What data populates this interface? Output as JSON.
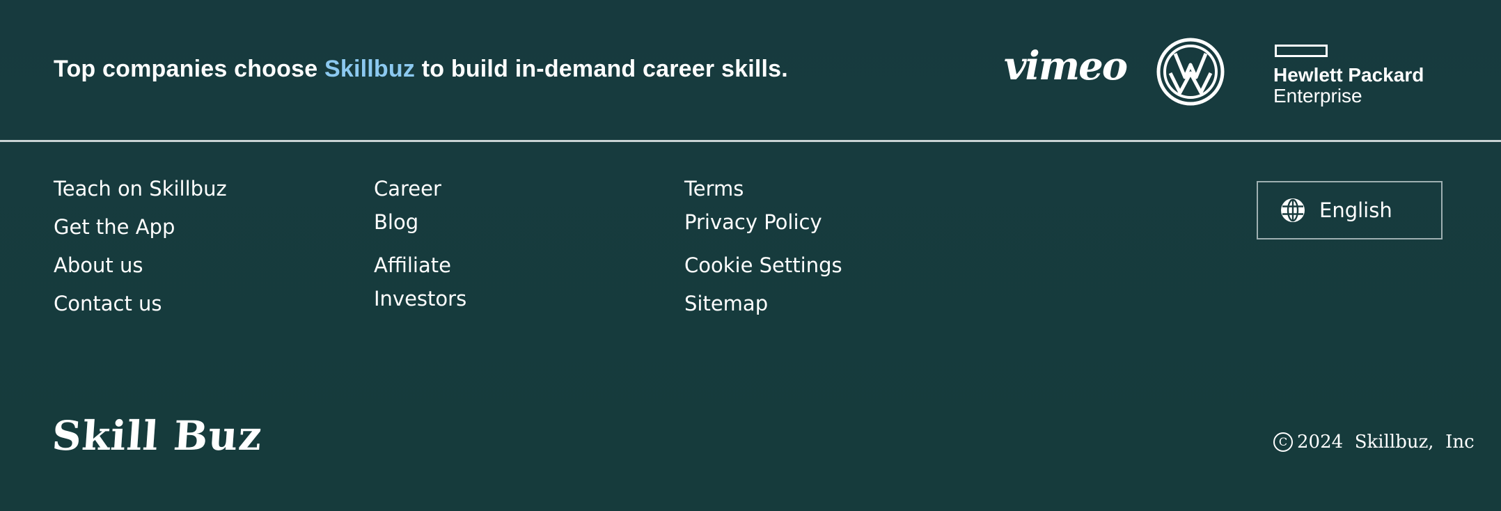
{
  "tagline": {
    "before": "Top companies choose ",
    "brand": "Skillbuz",
    "after": " to build in-demand career skills."
  },
  "partners": {
    "vimeo": "vimeo",
    "hpe_line1": "Hewlett Packard",
    "hpe_line2": "Enterprise"
  },
  "links": {
    "col1": [
      "Teach on Skillbuz",
      "Get the App",
      "About us",
      "Contact us"
    ],
    "col2": [
      "Career",
      "Blog",
      "Affiliate",
      "Investors"
    ],
    "col3": [
      "Terms",
      "Privacy Policy",
      "Cookie Settings",
      "Sitemap"
    ]
  },
  "language": {
    "label": "English",
    "icon": "globe-icon"
  },
  "footer": {
    "logo": "Skill Buz",
    "copyright_symbol": "C",
    "copyright_text": "2024  Skillbuz,  Inc"
  },
  "colors": {
    "background": "#183a3d",
    "brand_accent": "#8cc9f0",
    "text": "#ffffff",
    "divider": "#c9d3d4"
  }
}
